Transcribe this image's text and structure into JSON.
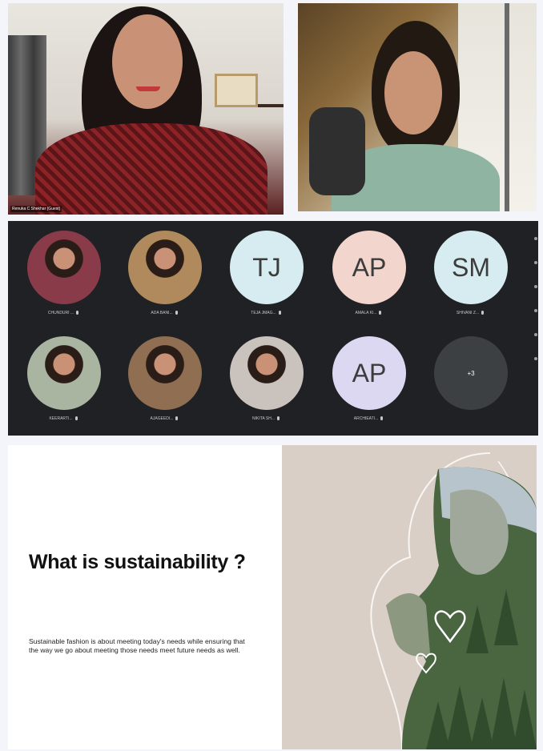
{
  "meeting": {
    "video_tiles": [
      {
        "caption": "Renuka C Shekhar (Guest)"
      },
      {
        "caption": ""
      }
    ],
    "participants": [
      {
        "name": "CHUNDURI ...",
        "initials": "",
        "type": "photo",
        "color": "#8a3b4a"
      },
      {
        "name": "ADA BANI...",
        "initials": "",
        "type": "photo",
        "color": "#b08a5c"
      },
      {
        "name": "TEJA JMAG...",
        "initials": "TJ",
        "type": "initials",
        "color": "#d6ecf0"
      },
      {
        "name": "AMALA KI...",
        "initials": "AP",
        "type": "initials",
        "color": "#f2d5cc"
      },
      {
        "name": "SHIVANI Z...",
        "initials": "SM",
        "type": "initials",
        "color": "#d6ecf0"
      },
      {
        "name": "KEERARTI...",
        "initials": "",
        "type": "photo",
        "color": "#a9b5a0"
      },
      {
        "name": "AJAGEEDI...",
        "initials": "",
        "type": "photo",
        "color": "#8f6e52"
      },
      {
        "name": "NIKITA SH...",
        "initials": "",
        "type": "photo",
        "color": "#c9c2bd"
      },
      {
        "name": "ARCHIEATI...",
        "initials": "AP",
        "type": "initials",
        "color": "#ddd8f2"
      },
      {
        "name": "",
        "initials": "+3",
        "type": "more",
        "color": "#3c4043"
      }
    ]
  },
  "slide": {
    "title": "What is sustainability ?",
    "body": "Sustainable fashion is about meeting today's needs while ensuring that the way we go about meeting those needs meet future needs as well."
  },
  "colors": {
    "gallery_bg": "#202124",
    "slide_right_bg": "#d9cfc6",
    "forest_green": "#3f5a34"
  }
}
